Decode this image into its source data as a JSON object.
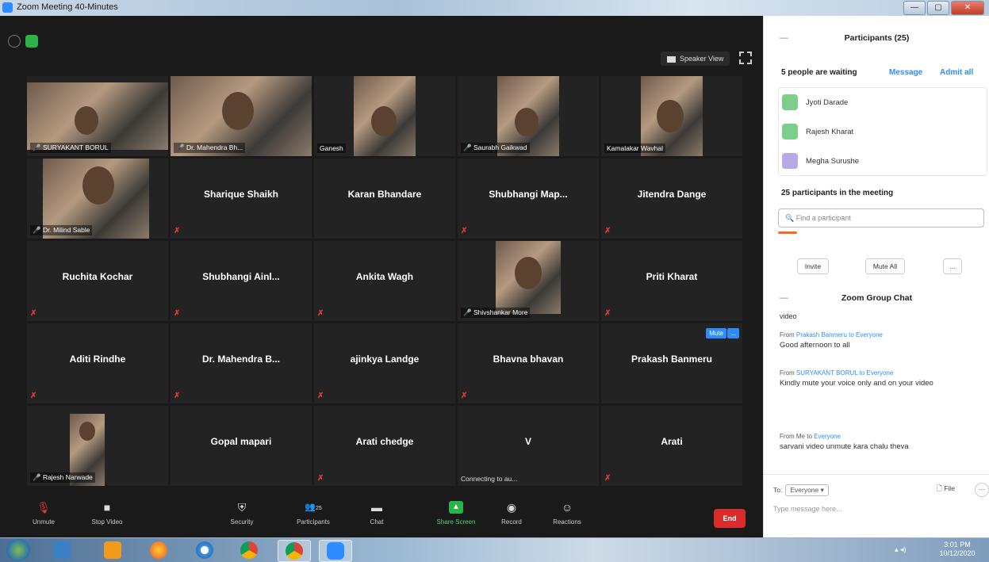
{
  "window": {
    "title": "Zoom Meeting 40-Minutes",
    "buttons": [
      "—",
      "▢",
      "✕"
    ]
  },
  "top": {
    "speaker_view": "Speaker View"
  },
  "tiles": [
    {
      "name": "",
      "label": "SURYAKANT BORUL",
      "type": "video",
      "muted": true
    },
    {
      "name": "",
      "label": "Dr. Mahendra Bh...",
      "type": "video",
      "muted": true,
      "active": true
    },
    {
      "name": "",
      "label": "Ganesh",
      "type": "video",
      "muted": false
    },
    {
      "name": "",
      "label": "Saurabh Gaikwad",
      "type": "video",
      "muted": true
    },
    {
      "name": "",
      "label": "Kamalakar Wavhal",
      "type": "video",
      "muted": false
    },
    {
      "name": "",
      "label": "Dr. Milind Sable",
      "type": "video",
      "muted": true
    },
    {
      "name": "Sharique Shaikh",
      "label": "",
      "type": "name",
      "muted": true
    },
    {
      "name": "Karan Bhandare",
      "label": "",
      "type": "name",
      "muted": false
    },
    {
      "name": "Shubhangi  Map...",
      "label": "",
      "type": "name",
      "muted": true
    },
    {
      "name": "Jitendra Dange",
      "label": "",
      "type": "name",
      "muted": true
    },
    {
      "name": "Ruchita Kochar",
      "label": "",
      "type": "name",
      "muted": true
    },
    {
      "name": "Shubhangi  Ainl...",
      "label": "",
      "type": "name",
      "muted": true
    },
    {
      "name": "Ankita Wagh",
      "label": "",
      "type": "name",
      "muted": true
    },
    {
      "name": "",
      "label": "Shivshankar More",
      "type": "video",
      "muted": true
    },
    {
      "name": "Priti Kharat",
      "label": "",
      "type": "name",
      "muted": true
    },
    {
      "name": "Aditi Rindhe",
      "label": "",
      "type": "name",
      "muted": true
    },
    {
      "name": "Dr. Mahendra B...",
      "label": "",
      "type": "name",
      "muted": true
    },
    {
      "name": "ajinkya Landge",
      "label": "",
      "type": "name",
      "muted": true
    },
    {
      "name": "Bhavna bhavan",
      "label": "",
      "type": "name",
      "muted": true
    },
    {
      "name": "Prakash Banmeru",
      "label": "",
      "type": "name",
      "muted": false,
      "hover": true
    },
    {
      "name": "",
      "label": "Rajesh Narwade",
      "type": "video",
      "muted": true
    },
    {
      "name": "Gopal mapari",
      "label": "",
      "type": "name",
      "muted": false
    },
    {
      "name": "Arati chedge",
      "label": "",
      "type": "name",
      "muted": true
    },
    {
      "name": "V",
      "label": "Connecting to au...",
      "type": "name",
      "muted": false
    },
    {
      "name": "Arati",
      "label": "",
      "type": "name",
      "muted": true
    }
  ],
  "hover_buttons": {
    "mute": "Mute",
    "more": "..."
  },
  "toolbar": {
    "unmute": "Unmute",
    "stop_video": "Stop Video",
    "security": "Security",
    "participants": "Participants",
    "participants_count": "25",
    "chat": "Chat",
    "share_screen": "Share Screen",
    "record": "Record",
    "reactions": "Reactions",
    "end": "End"
  },
  "panel": {
    "title": "Participants (25)",
    "waiting_text": "5 people are waiting",
    "message": "Message",
    "admit_all": "Admit all",
    "waiting": [
      {
        "name": "Jyoti Darade",
        "color": "#7ccf8a"
      },
      {
        "name": "Rajesh Kharat",
        "color": "#7ccf8a"
      },
      {
        "name": "Megha Surushe",
        "color": "#b7a8e6"
      }
    ],
    "count_text": "25 participants in the meeting",
    "search_placeholder": "Find a participant",
    "invite": "Invite",
    "mute_all": "Mute All",
    "more": "..."
  },
  "chat": {
    "title": "Zoom Group Chat",
    "first_line": "video",
    "messages": [
      {
        "from_prefix": "From ",
        "from": "Prakash Banmeru",
        "to": " to Everyone",
        "text": "Good afternoon to all"
      },
      {
        "from_prefix": "From ",
        "from": "SURYAKANT BORUL",
        "to": " to Everyone",
        "text": "Kindly mute your voice only and on your video"
      },
      {
        "from_prefix": "From Me to ",
        "from": "Everyone",
        "to": "",
        "text": "sarvani video unmute kara chalu theva"
      }
    ],
    "to_label": "To:",
    "to_value": "Everyone",
    "file": "File",
    "placeholder": "Type message here..."
  },
  "taskbar": {
    "time": "3:01 PM",
    "date": "10/12/2020"
  },
  "colors": {
    "accent": "#2d8cff",
    "end": "#d92c2c",
    "share": "#2bb34a",
    "active_outline": "#cfe633"
  }
}
